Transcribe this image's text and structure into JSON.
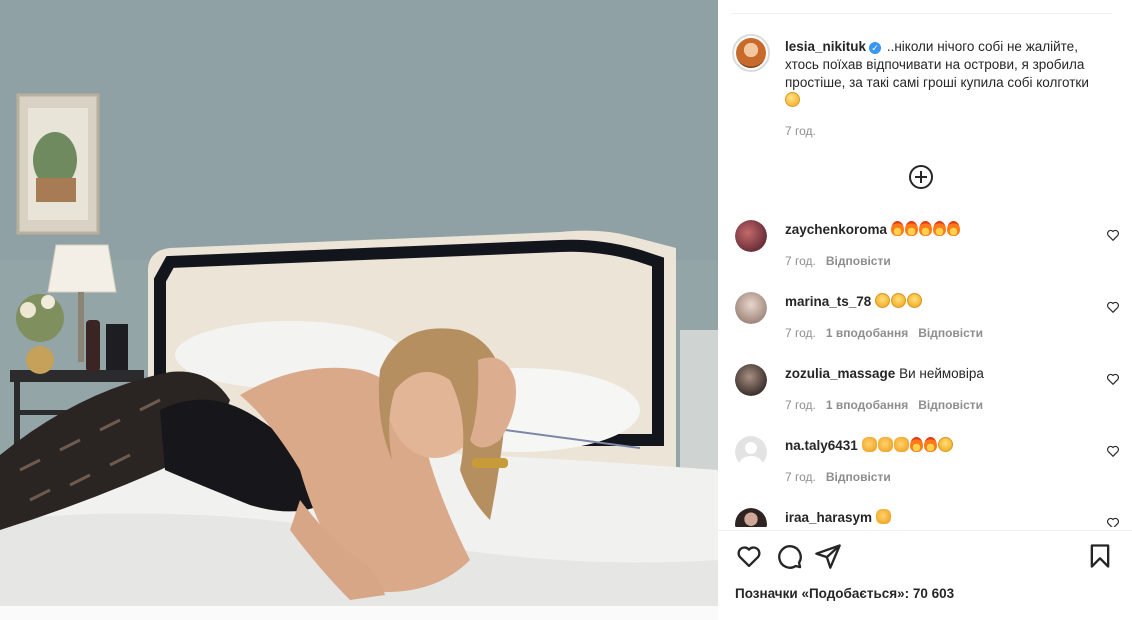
{
  "post": {
    "image_alt": "",
    "author": {
      "username": "lesia_nikituk",
      "verified": true,
      "caption": "..ніколи нічого собі не жалійте, хтось поїхав відпочивати на острови, я зробила простіше, за такі самі гроші купила собі колготки",
      "caption_emoji": "smirk-emoji",
      "time": "7 год."
    },
    "load_more_icon": "plus-circle-icon",
    "comments": [
      {
        "username": "zaychenkoroma",
        "text": "",
        "emojis": [
          "fire",
          "fire",
          "fire",
          "fire",
          "fire"
        ],
        "time": "7 год.",
        "likes": "",
        "reply": "Відповісти",
        "avatar_color": "#7a3b3b"
      },
      {
        "username": "marina_ts_78",
        "text": "",
        "emojis": [
          "laugh",
          "laugh",
          "laugh"
        ],
        "time": "7 год.",
        "likes": "1 вподобання",
        "reply": "Відповісти",
        "avatar_color": "#b9a89a"
      },
      {
        "username": "zozulia_massage",
        "text": "Ви неймовіра",
        "emojis": [],
        "time": "7 год.",
        "likes": "1 вподобання",
        "reply": "Відповісти",
        "avatar_color": "#5a4a42"
      },
      {
        "username": "na.taly6431",
        "text": "",
        "emojis": [
          "clap",
          "clap",
          "clap",
          "fire",
          "fire",
          "hearteyes"
        ],
        "time": "7 год.",
        "likes": "",
        "reply": "Відповісти",
        "avatar_color": "#e0e0e0"
      },
      {
        "username": "iraa_harasym",
        "text": "",
        "emojis": [
          "clap"
        ],
        "time": "",
        "likes": "",
        "reply": "",
        "avatar_color": "#3a2f2c"
      }
    ],
    "actions": {
      "like_icon": "heart-icon",
      "comment_icon": "comment-icon",
      "share_icon": "send-icon",
      "save_icon": "bookmark-icon"
    },
    "likes_label": "Позначки «Подобається»: 70 603"
  }
}
